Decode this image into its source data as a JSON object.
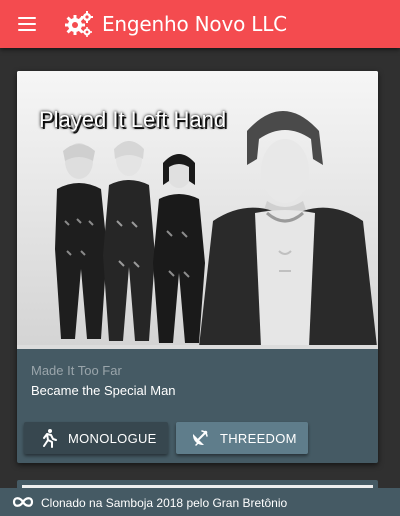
{
  "app_bar": {
    "title": "Engenho Novo LLC",
    "menu_icon": "menu-icon",
    "logo_icon": "gears-icon",
    "background_color": "#f44b4f"
  },
  "card": {
    "media_title": "Played It Left Hand",
    "subtitle": "Made It Too Far",
    "supporting_text": "Became the Special Man",
    "actions": [
      {
        "label": "MONOLOGUE",
        "icon": "running-person-icon"
      },
      {
        "label": "THREEDOM",
        "icon": "satellite-dish-icon"
      }
    ],
    "background_color": "#455a64"
  },
  "footer": {
    "text": "Clonado na Samboja 2018 pelo Gran Bretônio",
    "icon": "infinity-icon"
  }
}
